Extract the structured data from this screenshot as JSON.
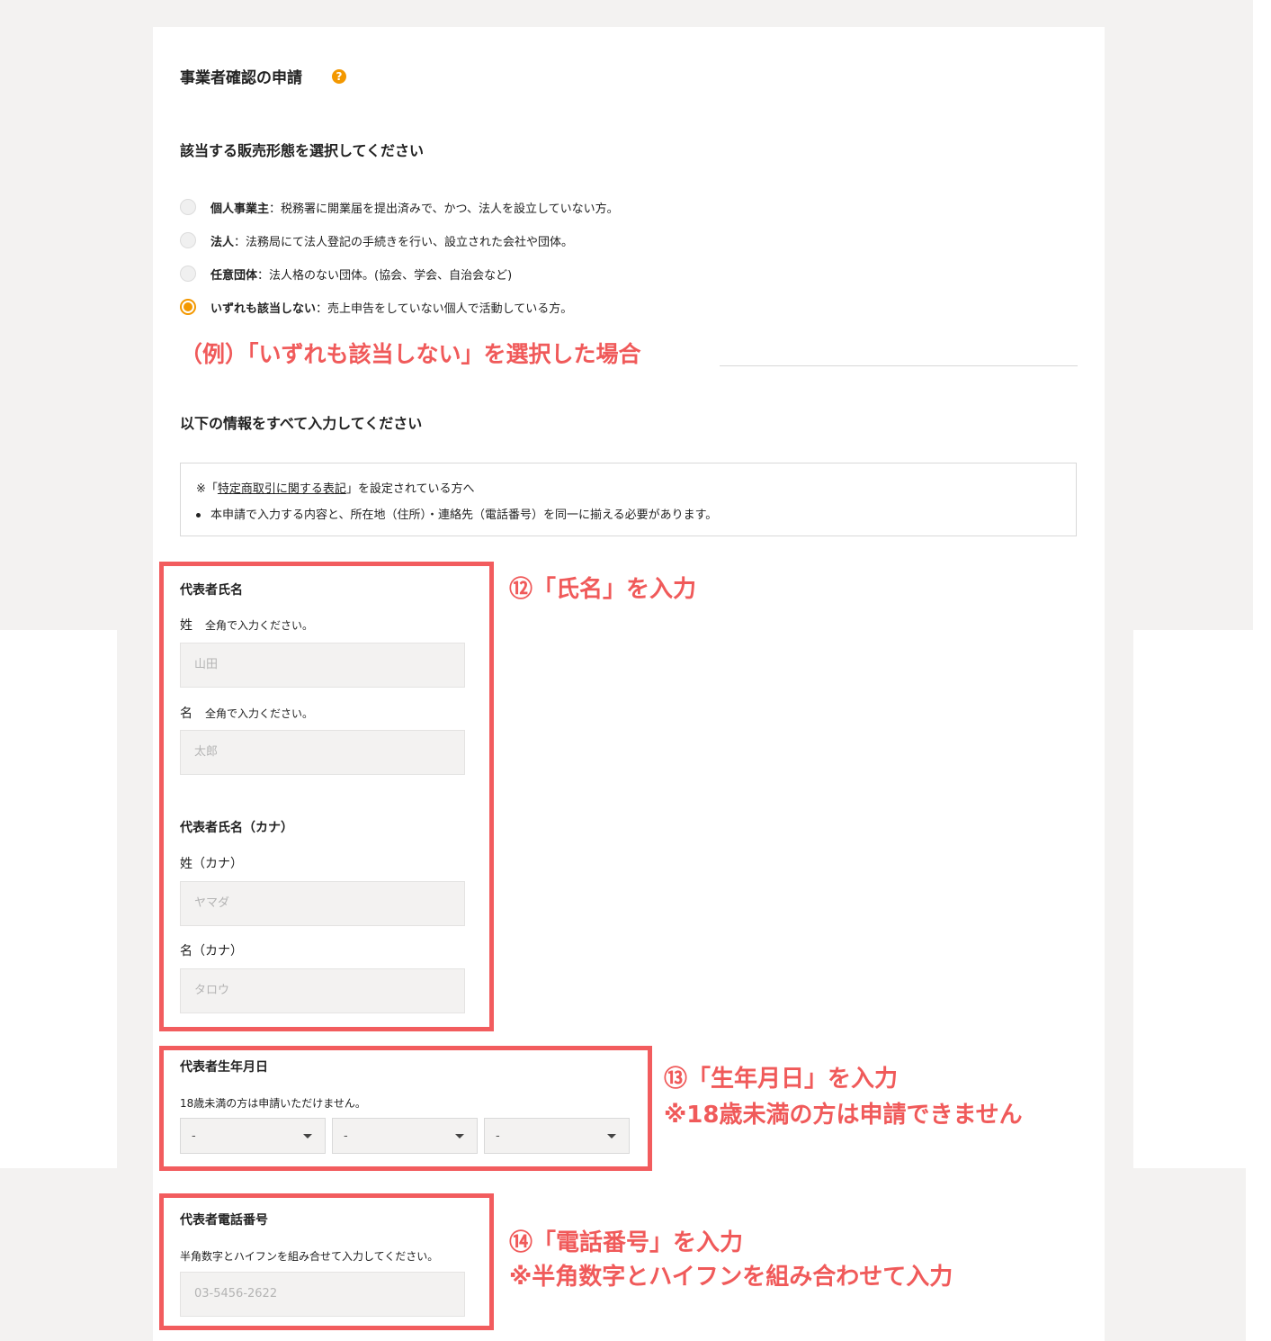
{
  "page": {
    "title": "事業者確認の申請",
    "help_icon": "?"
  },
  "sales_type": {
    "heading": "該当する販売形態を選択してください",
    "options": [
      {
        "name": "個人事業主",
        "desc": "：税務署に開業届を提出済みで、かつ、法人を設立していない方。",
        "selected": false
      },
      {
        "name": "法人",
        "desc": "：法務局にて法人登記の手続きを行い、設立された会社や団体。",
        "selected": false
      },
      {
        "name": "任意団体",
        "desc": "：法人格のない団体。(協会、学会、自治会など)",
        "selected": false
      },
      {
        "name": "いずれも該当しない",
        "desc": "：売上申告をしていない個人で活動している方。",
        "selected": true
      }
    ]
  },
  "annotations": {
    "example": "（例）「いずれも該当しない」を選択した場合",
    "name": "⑫「氏名」を入力",
    "birth_line1": "⑬「生年月日」を入力",
    "birth_line2": "※18歳未満の方は申請できません",
    "phone_line1": "⑭「電話番号」を入力",
    "phone_line2": "※半角数字とハイフンを組み合わせて入力"
  },
  "info": {
    "heading": "以下の情報をすべて入力してください",
    "notice_prefix": "※「",
    "notice_link": "特定商取引に関する表記",
    "notice_suffix": "」を設定されている方へ",
    "notice_bullet": "本申請で入力する内容と、所在地（住所）・連絡先（電話番号）を同一に揃える必要があります。"
  },
  "rep_name": {
    "heading": "代表者氏名",
    "last_label": "姓",
    "last_hint": "全角で入力ください。",
    "last_placeholder": "山田",
    "first_label": "名",
    "first_hint": "全角で入力ください。",
    "first_placeholder": "太郎"
  },
  "rep_name_kana": {
    "heading": "代表者氏名（カナ）",
    "last_label": "姓（カナ）",
    "last_placeholder": "ヤマダ",
    "first_label": "名（カナ）",
    "first_placeholder": "タロウ"
  },
  "birthdate": {
    "heading": "代表者生年月日",
    "hint": "18歳未満の方は申請いただけません。",
    "year_value": "-",
    "month_value": "-",
    "day_value": "-"
  },
  "phone": {
    "heading": "代表者電話番号",
    "hint": "半角数字とハイフンを組み合せて入力してください。",
    "placeholder": "03-5456-2622"
  },
  "colors": {
    "accent": "#f39800",
    "annotation": "#f05a5a",
    "highlight_border": "#f25c5e",
    "background": "#f3f2f1"
  }
}
